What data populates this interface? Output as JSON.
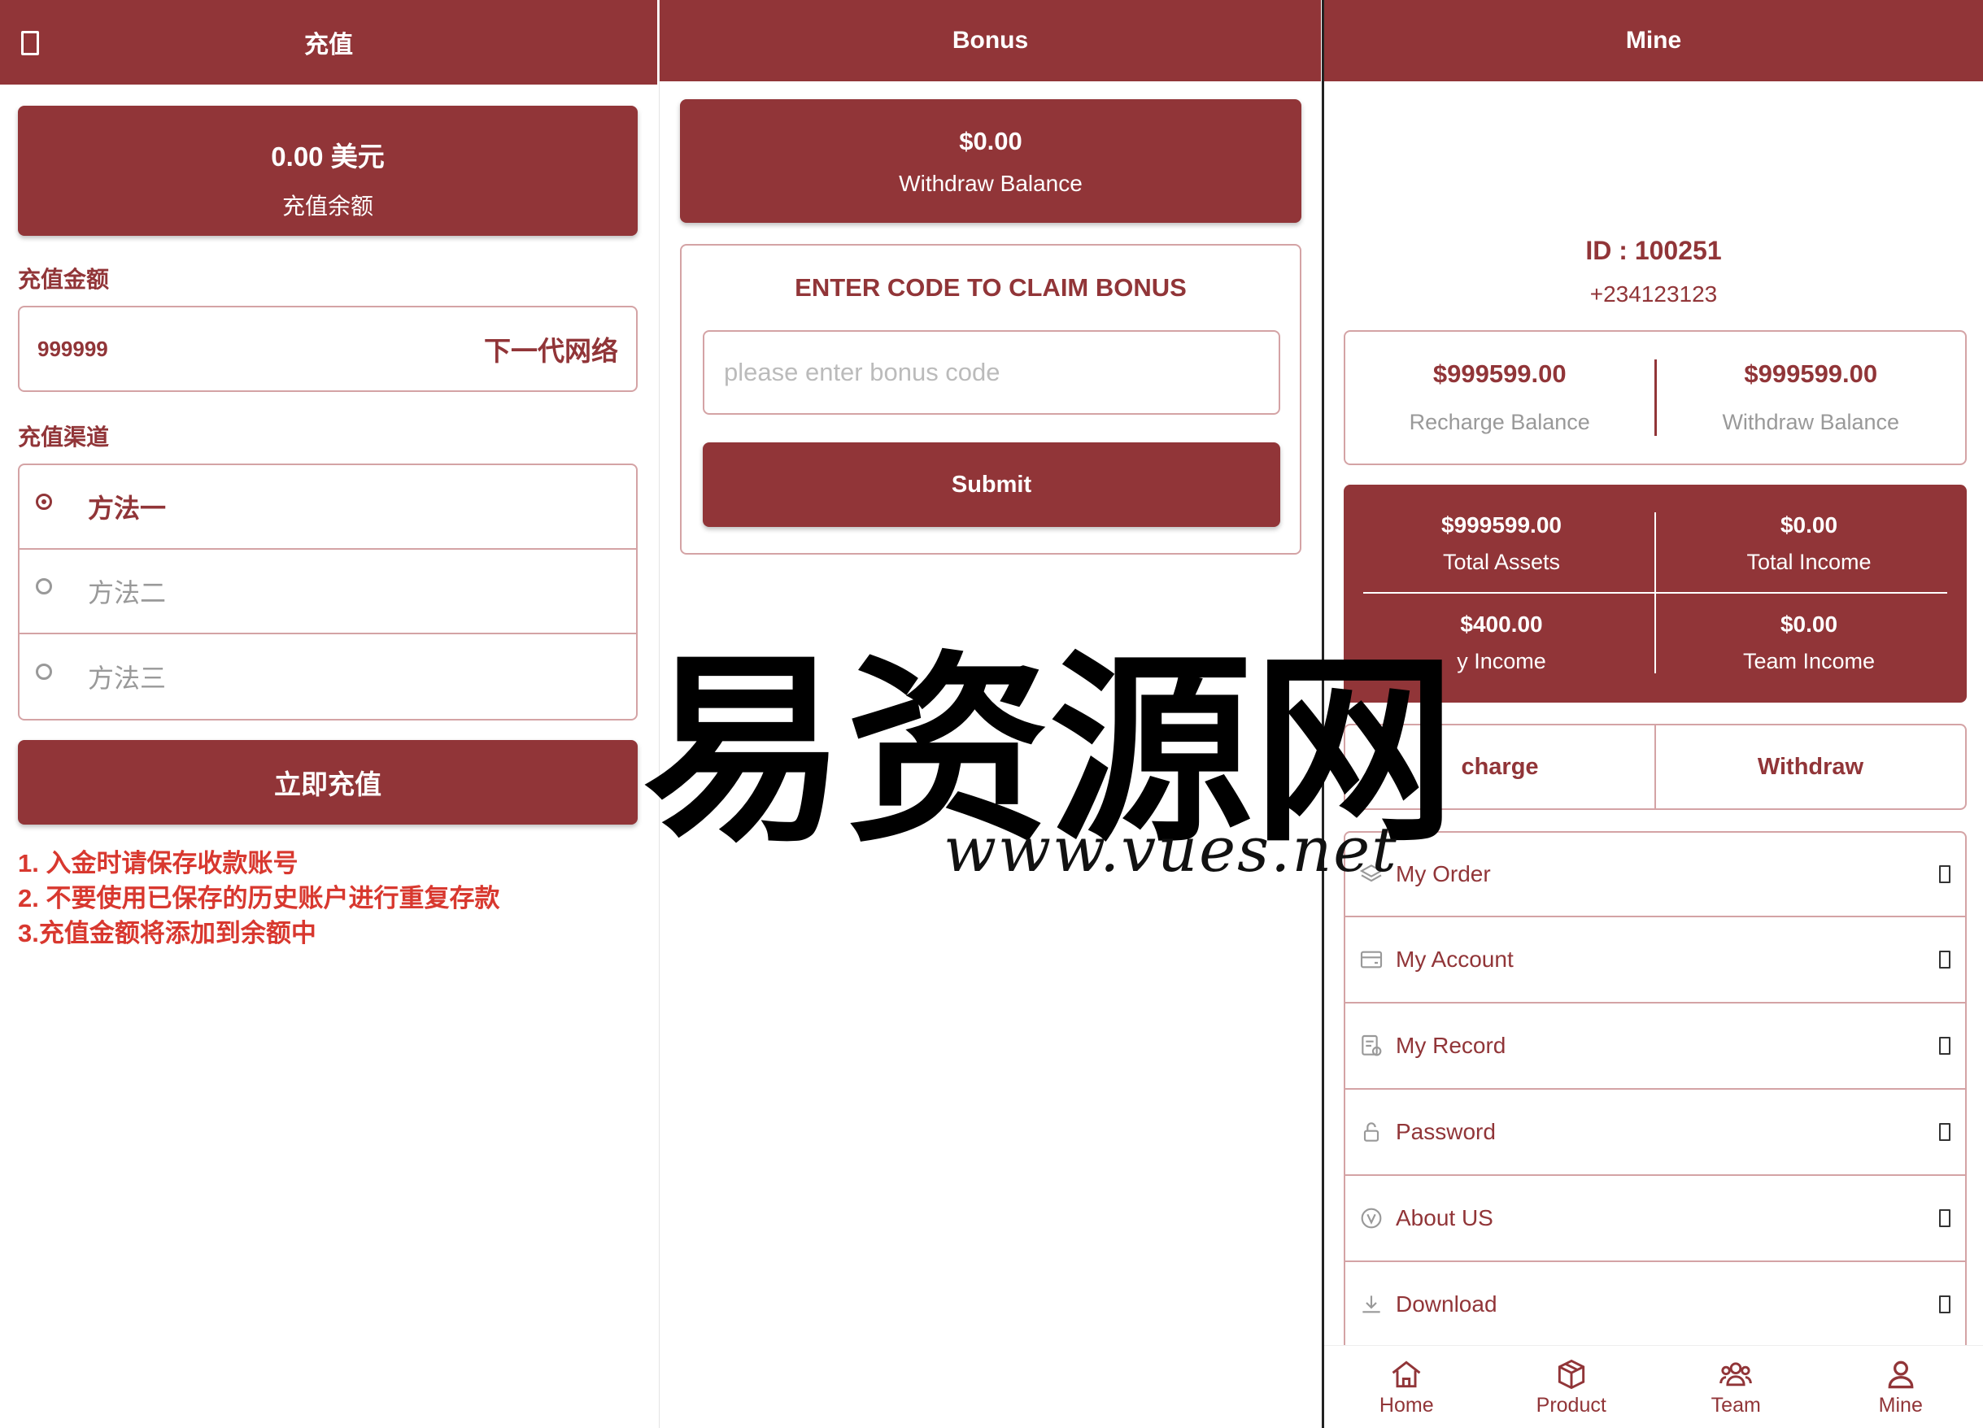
{
  "recharge": {
    "title": "充值",
    "balance_amount": "0.00 美元",
    "balance_label": "充值余额",
    "amount_label": "充值金额",
    "amount_value": "999999",
    "network": "下一代网络",
    "channel_label": "充值渠道",
    "methods": [
      "方法一",
      "方法二",
      "方法三"
    ],
    "submit": "立即充值",
    "notes": [
      "1. 入金时请保存收款账号",
      "2. 不要使用已保存的历史账户进行重复存款",
      "3.充值金额将添加到余额中"
    ]
  },
  "bonus": {
    "title": "Bonus",
    "withdraw_amount": "$0.00",
    "withdraw_label": "Withdraw Balance",
    "code_title": "ENTER CODE TO CLAIM BONUS",
    "code_placeholder": "please enter bonus code",
    "submit": "Submit"
  },
  "mine": {
    "title": "Mine",
    "id": "ID : 100251",
    "phone": "+234123123",
    "recharge_balance": "$999599.00",
    "recharge_balance_label": "Recharge Balance",
    "withdraw_balance": "$999599.00",
    "withdraw_balance_label": "Withdraw Balance",
    "total_assets": "$999599.00",
    "total_assets_label": "Total Assets",
    "total_income": "$0.00",
    "total_income_label": "Total Income",
    "daily_income": "$400.00",
    "daily_income_label": "y Income",
    "team_income": "$0.00",
    "team_income_label": "Team Income",
    "recharge_btn": "charge",
    "withdraw_btn": "Withdraw",
    "menu": [
      "My Order",
      "My Account",
      "My Record",
      "Password",
      "About US",
      "Download"
    ],
    "tabs": [
      "Home",
      "Product",
      "Team",
      "Mine"
    ]
  },
  "watermark": {
    "chars": "易资源网",
    "url": "www.vues.net"
  },
  "colors": {
    "brand": "#913538",
    "note_red": "#d8382f",
    "border": "#d4a3a5"
  }
}
